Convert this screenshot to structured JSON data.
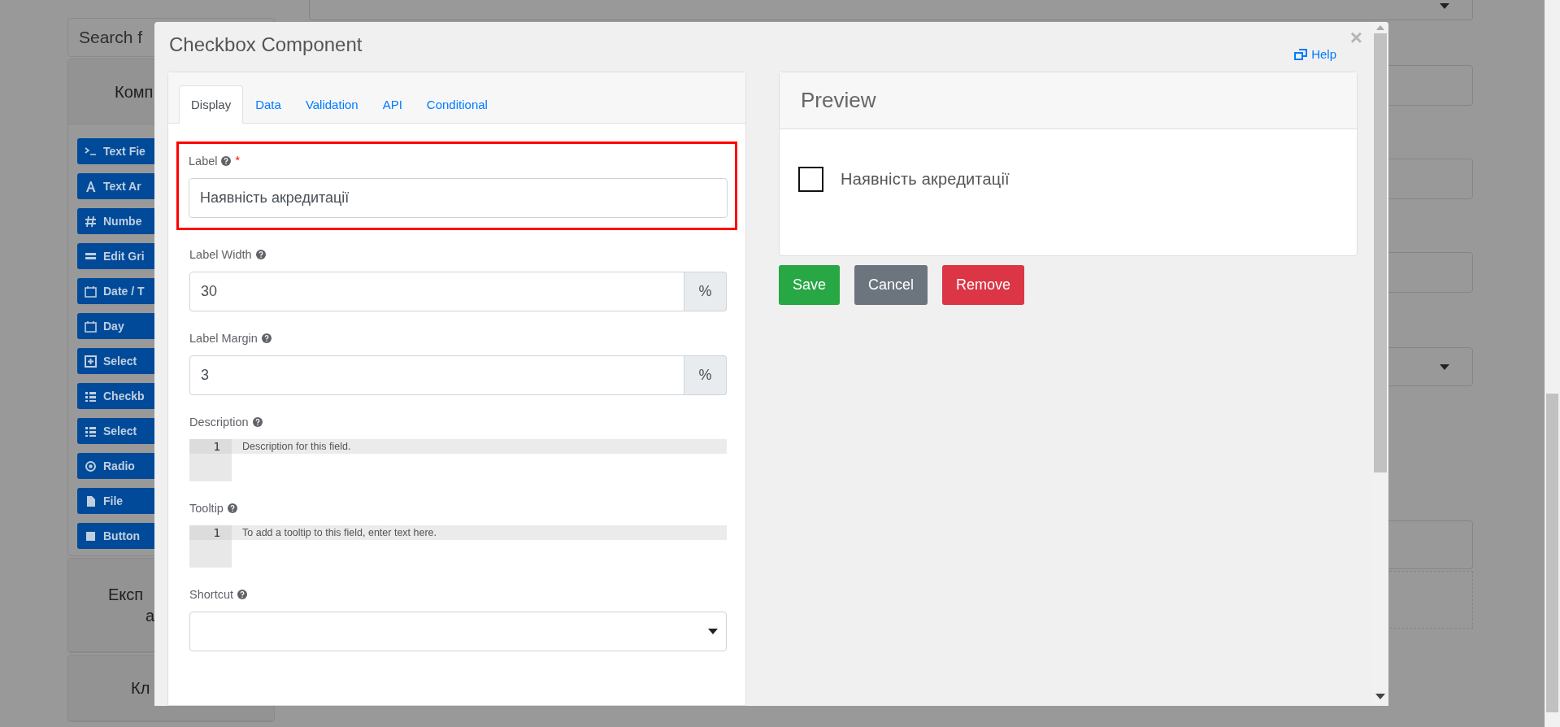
{
  "background": {
    "search": {
      "placeholder": "Search f"
    },
    "panels": [
      {
        "title_lines": [
          "Комп"
        ],
        "components": [
          {
            "label": "Text Fie"
          },
          {
            "label": "Text Ar"
          },
          {
            "label": "Numbe"
          },
          {
            "label": "Edit Gri"
          },
          {
            "label": "Date / T"
          },
          {
            "label": "Day"
          },
          {
            "label": "Select"
          },
          {
            "label": "Checkb"
          },
          {
            "label": "Select"
          },
          {
            "label": "Radio"
          },
          {
            "label": "File"
          },
          {
            "label": "Button"
          }
        ]
      },
      {
        "title_lines": [
          "Експ",
          "а"
        ]
      },
      {
        "title_lines": [
          "Кл"
        ]
      }
    ],
    "fields": [
      {
        "kind": "select"
      },
      {
        "kind": "input"
      },
      {
        "kind": "input"
      },
      {
        "kind": "input"
      },
      {
        "kind": "select"
      },
      {
        "kind": "input"
      },
      {
        "kind": "dropzone"
      }
    ]
  },
  "modal": {
    "title": "Checkbox Component",
    "help": "Help",
    "close": "×",
    "tabs": [
      {
        "label": "Display",
        "selected": true
      },
      {
        "label": "Data",
        "selected": false
      },
      {
        "label": "Validation",
        "selected": false
      },
      {
        "label": "API",
        "selected": false
      },
      {
        "label": "Conditional",
        "selected": false
      }
    ],
    "fields": [
      {
        "kind": "text",
        "label": "Label",
        "required_mark": "*",
        "highlighted": true,
        "value": "Наявність акредитації"
      },
      {
        "kind": "addon",
        "label": "Label Width",
        "value": "30",
        "addon": "%"
      },
      {
        "kind": "addon",
        "label": "Label Margin",
        "value": "3",
        "addon": "%"
      },
      {
        "kind": "code",
        "label": "Description",
        "line": "1",
        "placeholder": "Description for this field."
      },
      {
        "kind": "code",
        "label": "Tooltip",
        "line": "1",
        "placeholder": "To add a tooltip to this field, enter text here."
      },
      {
        "kind": "select",
        "label": "Shortcut"
      }
    ],
    "preview": {
      "title": "Preview",
      "checkbox": {
        "label": "Наявність акредитації",
        "checked": false
      }
    },
    "buttons": [
      {
        "label": "Save",
        "kind": "success"
      },
      {
        "label": "Cancel",
        "kind": "secondary"
      },
      {
        "label": "Remove",
        "kind": "danger"
      }
    ]
  }
}
